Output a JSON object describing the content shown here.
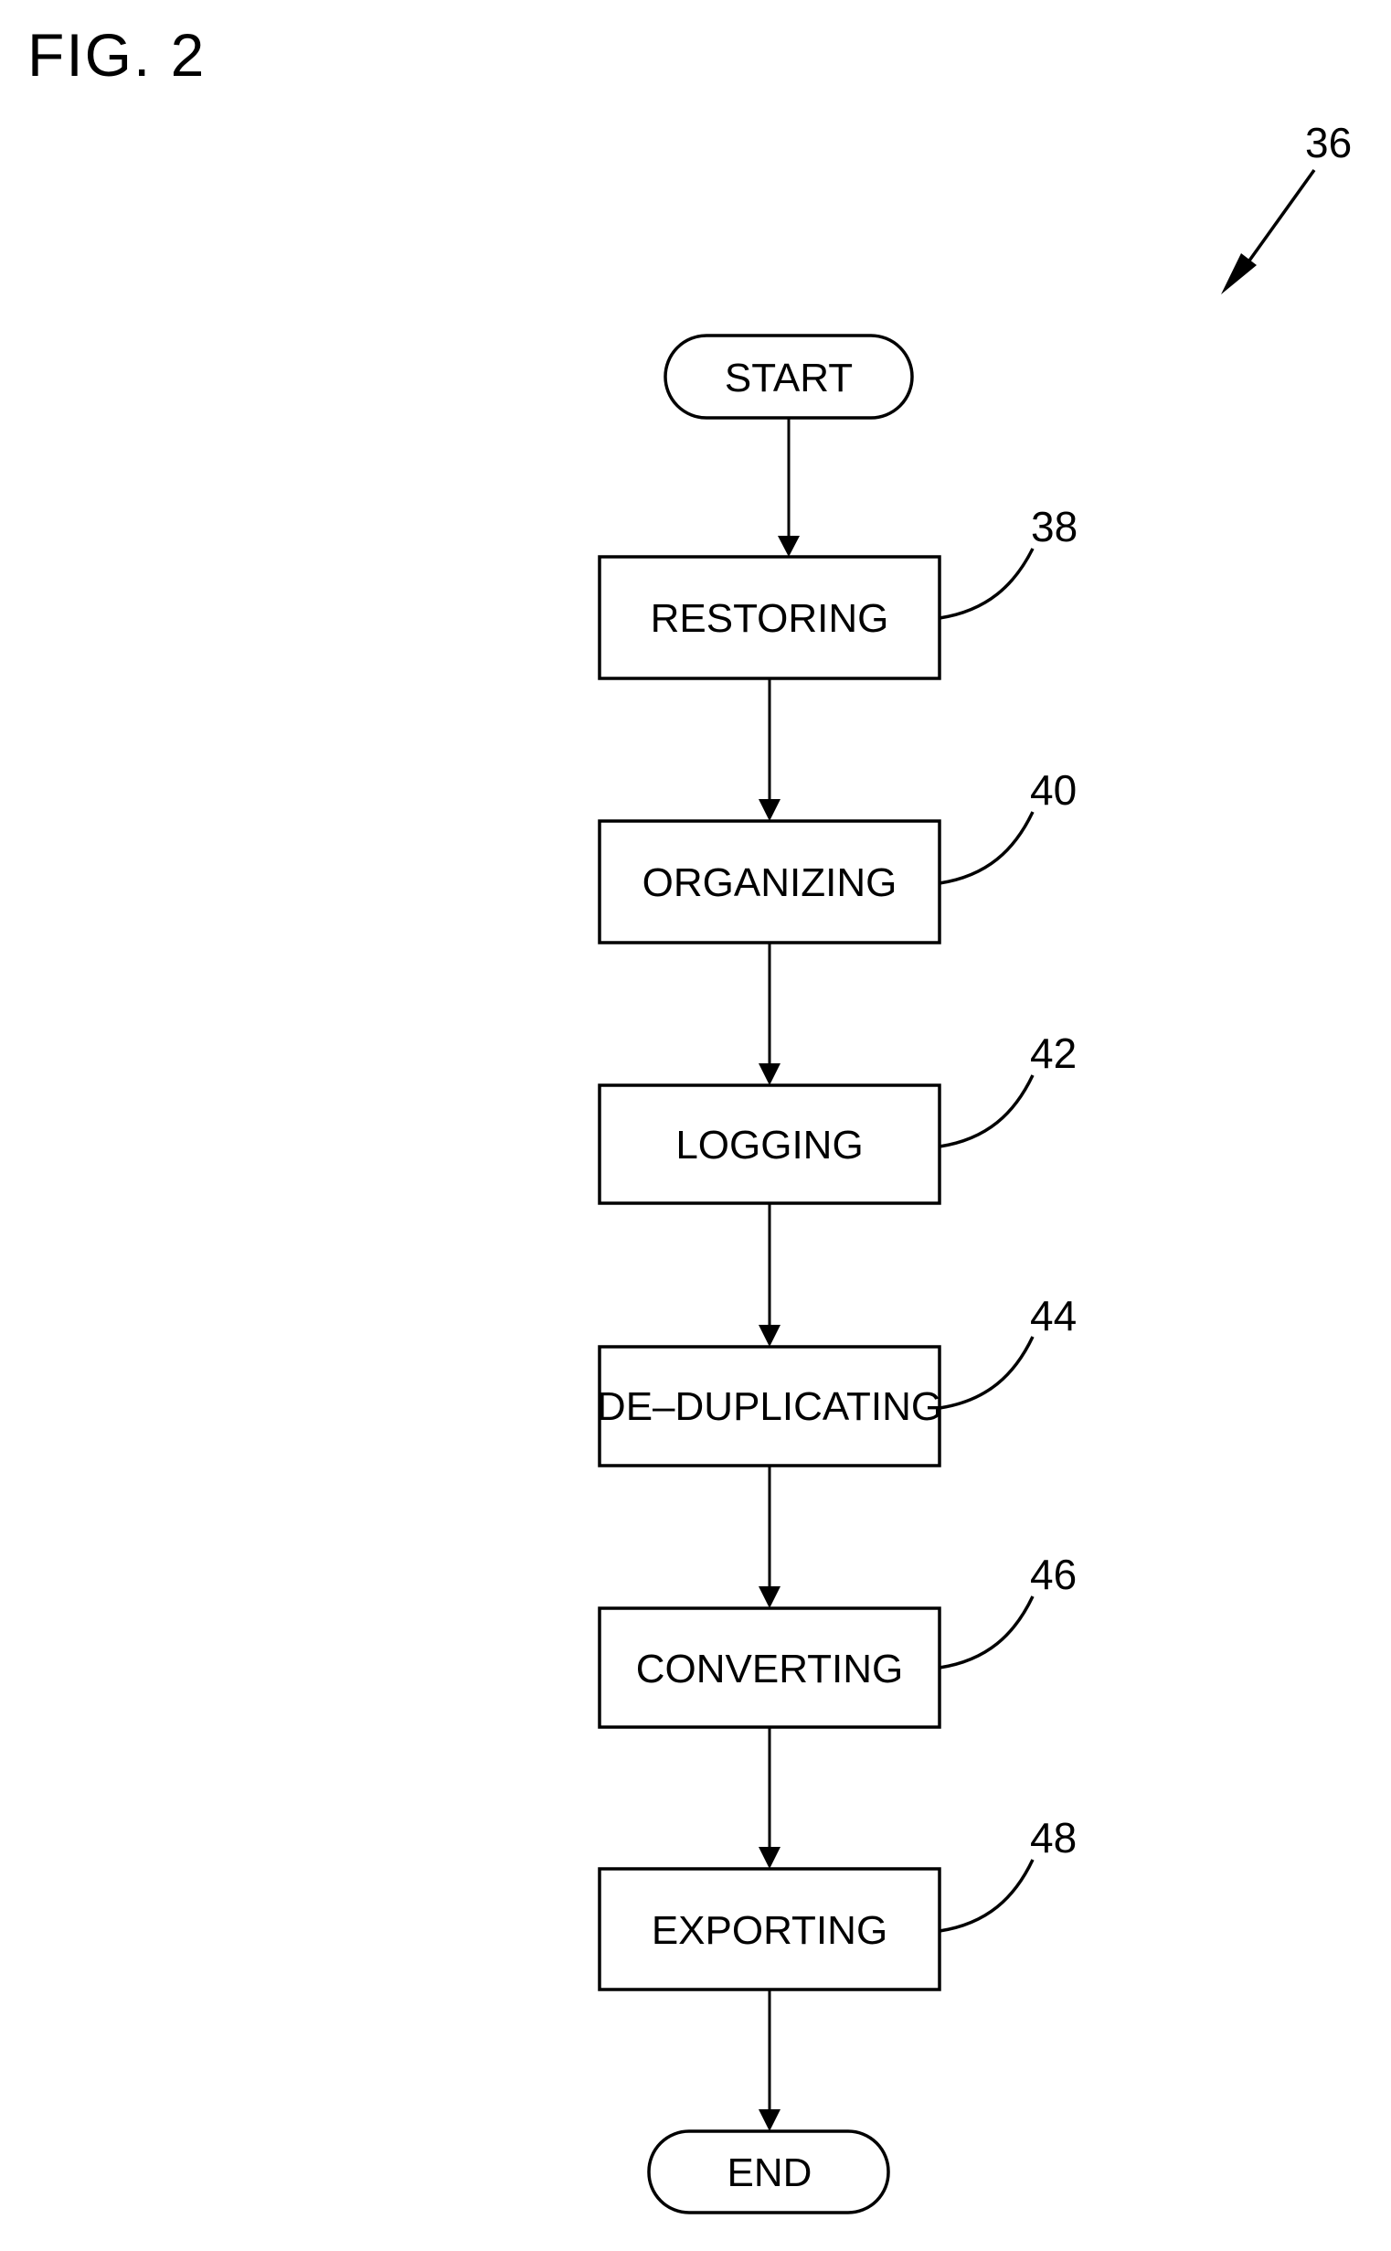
{
  "figure": {
    "title": "FIG. 2",
    "reference_numeral": "36"
  },
  "flowchart": {
    "start": {
      "label": "START"
    },
    "steps": [
      {
        "label": "RESTORING",
        "ref": "38"
      },
      {
        "label": "ORGANIZING",
        "ref": "40"
      },
      {
        "label": "LOGGING",
        "ref": "42"
      },
      {
        "label": "DE–DUPLICATING",
        "ref": "44"
      },
      {
        "label": "CONVERTING",
        "ref": "46"
      },
      {
        "label": "EXPORTING",
        "ref": "48"
      }
    ],
    "end": {
      "label": "END"
    }
  },
  "colors": {
    "line": "#000000",
    "background": "#ffffff"
  }
}
